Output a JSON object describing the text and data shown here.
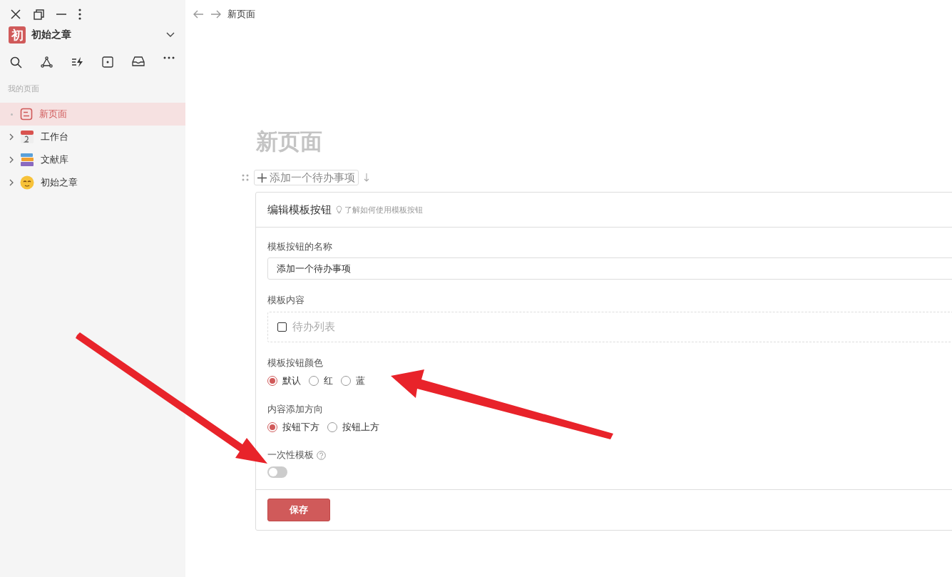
{
  "workspace": {
    "initial": "初",
    "name": "初始之章"
  },
  "sidebar": {
    "section_title": "我的页面",
    "items": [
      {
        "label": "新页面",
        "kind": "page",
        "expandable": false,
        "selected": true
      },
      {
        "label": "工作台",
        "kind": "calendar",
        "expandable": true,
        "selected": false
      },
      {
        "label": "文献库",
        "kind": "books",
        "expandable": true,
        "selected": false
      },
      {
        "label": "初始之章",
        "kind": "emoji",
        "expandable": true,
        "selected": false
      }
    ]
  },
  "breadcrumb": "新页面",
  "page": {
    "title": "新页面",
    "template_button": "添加一个待办事项"
  },
  "editor": {
    "title": "编辑模板按钮",
    "help_link": "了解如何使用模板按钮",
    "name_label": "模板按钮的名称",
    "name_value": "添加一个待办事项",
    "content_label": "模板内容",
    "content_item": {
      "placeholder": "待办列表",
      "checked": false
    },
    "color_label": "模板按钮颜色",
    "colors": [
      {
        "label": "默认",
        "selected": true
      },
      {
        "label": "红",
        "selected": false
      },
      {
        "label": "蓝",
        "selected": false
      }
    ],
    "direction_label": "内容添加方向",
    "directions": [
      {
        "label": "按钮下方",
        "selected": true
      },
      {
        "label": "按钮上方",
        "selected": false
      }
    ],
    "one_time_label": "一次性模板",
    "one_time": {
      "on": false
    },
    "save": "保存"
  },
  "annotations": [
    {
      "kind": "arrow"
    },
    {
      "kind": "arrow"
    }
  ]
}
